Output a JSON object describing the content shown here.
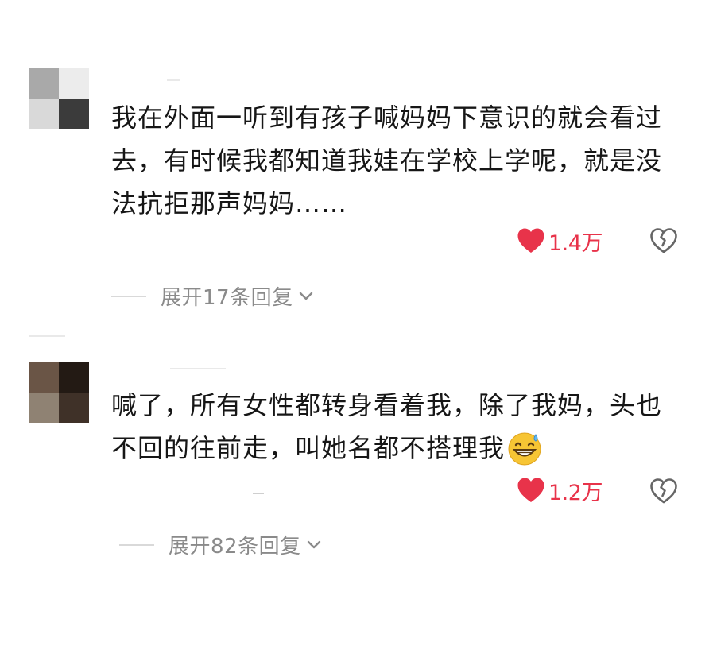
{
  "comments": [
    {
      "text_lines": [
        "我在外面一听到有孩子喊妈妈下意识的就会看过",
        "去，有时候我都知道我娃在学校上学呢，就是没",
        "法抗拒那声妈妈……"
      ],
      "likes": "1.4万",
      "replies_label": "展开17条回复",
      "avatar_colors": [
        "#a9a9a9",
        "#ececec",
        "#d9d9d9",
        "#3b3b3b"
      ]
    },
    {
      "text_lines": [
        "喊了，所有女性都转身看着我，除了我妈，头也",
        "不回的往前走，叫她名都不搭理我"
      ],
      "likes": "1.2万",
      "replies_label": "展开82条回复",
      "avatar_colors": [
        "#6a5546",
        "#231a14",
        "#8f8273",
        "#3f3128"
      ]
    }
  ],
  "colors": {
    "like_red": "#e8334a",
    "secondary_text": "#8a8a8a",
    "icon_gray": "#666666"
  },
  "icons": {
    "like": "heart-icon",
    "dislike": "broken-heart-icon",
    "expand": "chevron-down-icon",
    "emoji": "grinning-sweat-emoji"
  }
}
